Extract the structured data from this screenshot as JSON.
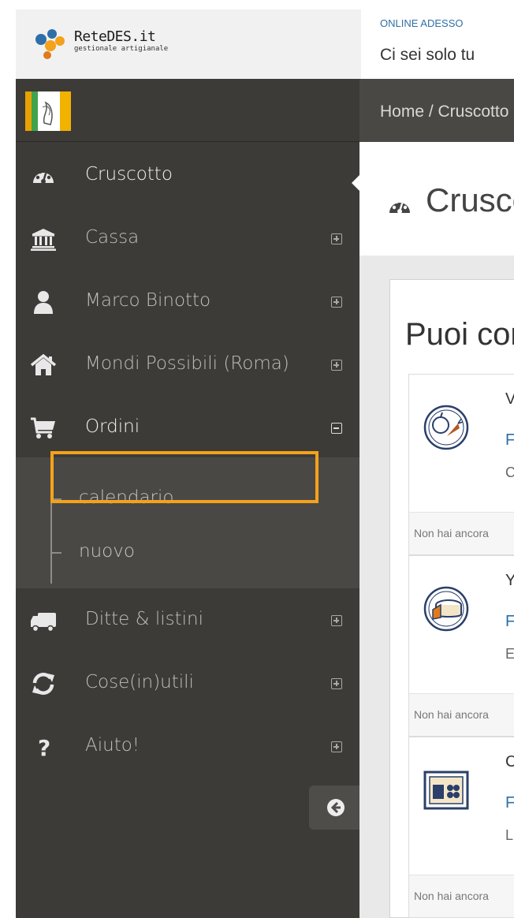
{
  "header": {
    "logo_title": "ReteDES.it",
    "logo_subtitle": "gestionale artigianale",
    "online_label": "ONLINE ADESSO",
    "online_message": "Ci sei solo tu"
  },
  "colors": {
    "sidebar_bg": "#3d3b38",
    "submenu_bg": "#4a4845",
    "highlight": "#f4a21b",
    "link": "#2e6fa7"
  },
  "sidebar": {
    "items": [
      {
        "label": "Cruscotto",
        "icon": "dashboard-icon",
        "active": true
      },
      {
        "label": "Cassa",
        "icon": "bank-icon",
        "toggle": "plus"
      },
      {
        "label": "Marco Binotto",
        "icon": "user-icon",
        "toggle": "plus"
      },
      {
        "label": "Mondi Possibili (Roma)",
        "icon": "home-icon",
        "toggle": "plus"
      },
      {
        "label": "Ordini",
        "icon": "cart-icon",
        "toggle": "minus",
        "expanded": true
      },
      {
        "label": "Ditte & listini",
        "icon": "truck-icon",
        "toggle": "plus"
      },
      {
        "label": "Cose(in)utili",
        "icon": "refresh-icon",
        "toggle": "plus"
      },
      {
        "label": "Aiuto!",
        "icon": "question-icon",
        "toggle": "plus"
      }
    ],
    "submenu": [
      {
        "label": "calendario"
      },
      {
        "label": "nuovo",
        "highlighted": true
      }
    ],
    "collapse_icon": "arrow-left-circle-icon"
  },
  "main": {
    "breadcrumb": "Home /  Cruscotto",
    "page_title": "Cruscotto",
    "panel_title": "Puoi completare",
    "cards": [
      {
        "name": "V",
        "link": "F",
        "desc": "C",
        "note": "Non hai ancora"
      },
      {
        "name": "Y",
        "link": "F",
        "desc": "E",
        "note": "Non hai ancora"
      },
      {
        "name": "C",
        "link": "F",
        "desc": "L",
        "note": "Non hai ancora"
      }
    ]
  }
}
